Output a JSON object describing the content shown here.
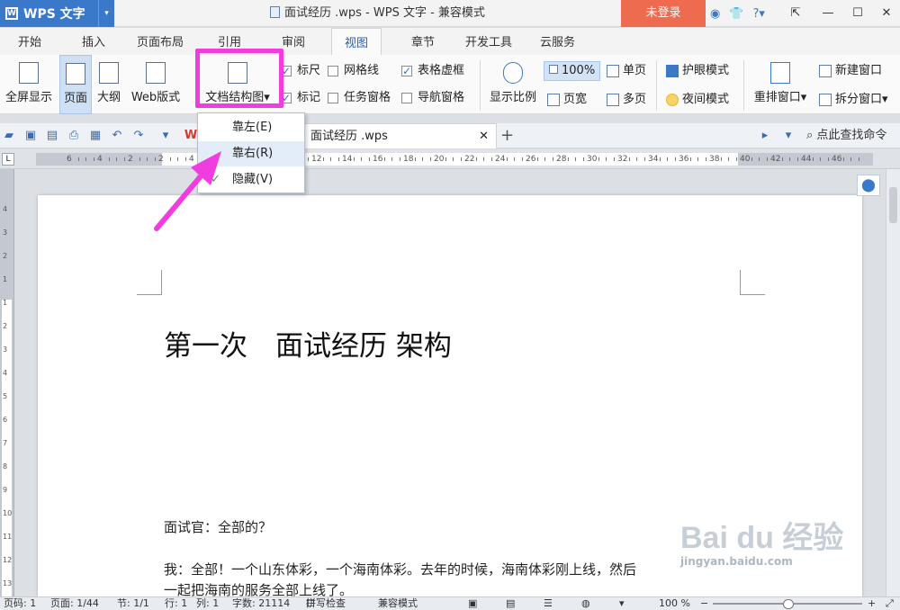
{
  "titlebar": {
    "app_name": "WPS 文字",
    "window_title": "面试经历 .wps - WPS 文字 - 兼容模式",
    "login": "未登录"
  },
  "tabs": [
    "开始",
    "插入",
    "页面布局",
    "引用",
    "审阅",
    "视图",
    "章节",
    "开发工具",
    "云服务"
  ],
  "active_tab": "视图",
  "ribbon": {
    "fullscreen": "全屏显示",
    "page": "页面",
    "outline": "大纲",
    "web": "Web版式",
    "docmap": "文档结构图",
    "ruler": "标尺",
    "gridlines": "网格线",
    "table_dashes": "表格虚框",
    "marks": "标记",
    "task_pane": "任务窗格",
    "nav_pane": "导航窗格",
    "zoom": "显示比例",
    "zoom_pct": "100%",
    "page_width": "页宽",
    "single_page": "单页",
    "multi_page": "多页",
    "eye_care": "护眼模式",
    "night_mode": "夜间模式",
    "arrange": "重排窗口",
    "new_window": "新建窗口",
    "split_window": "拆分窗口"
  },
  "doc_tab": {
    "name": "面试经历 .wps",
    "find_placeholder": "点此查找命令"
  },
  "menu": {
    "items": [
      "靠左(E)",
      "靠右(R)",
      "隐藏(V)"
    ]
  },
  "ruler_numbers": [
    "6",
    "4",
    "2",
    "2",
    "4",
    "6",
    "8",
    "10",
    "12",
    "14",
    "16",
    "18",
    "20",
    "22",
    "24",
    "26",
    "28",
    "30",
    "32",
    "34",
    "36",
    "38",
    "40",
    "42",
    "44",
    "46"
  ],
  "vruler_numbers": [
    "4",
    "3",
    "2",
    "1",
    "1",
    "2",
    "3",
    "4",
    "5",
    "6",
    "7",
    "8",
    "9",
    "10",
    "11",
    "12",
    "13"
  ],
  "document": {
    "title": "第一次　面试经历 架构",
    "lines": [
      "面试官：全部的？",
      "我：全部！一个山东体彩，一个海南体彩。去年的时候，海南体彩刚上线，然后",
      "一起把海南的服务全部上线了。"
    ]
  },
  "status": {
    "page_code": "页码: 1",
    "pages": "页面: 1/44",
    "section": "节: 1/1",
    "row": "行: 1",
    "col": "列: 1",
    "words": "字数: 21114",
    "spell": "拼写检查",
    "compat": "兼容模式",
    "zoom": "100 %"
  },
  "watermark": {
    "brand": "Bai du 经验",
    "url": "jingyan.baidu.com"
  },
  "colors": {
    "accent": "#3a78c9",
    "login": "#ef6b4f",
    "highlight": "#f13ce0"
  }
}
